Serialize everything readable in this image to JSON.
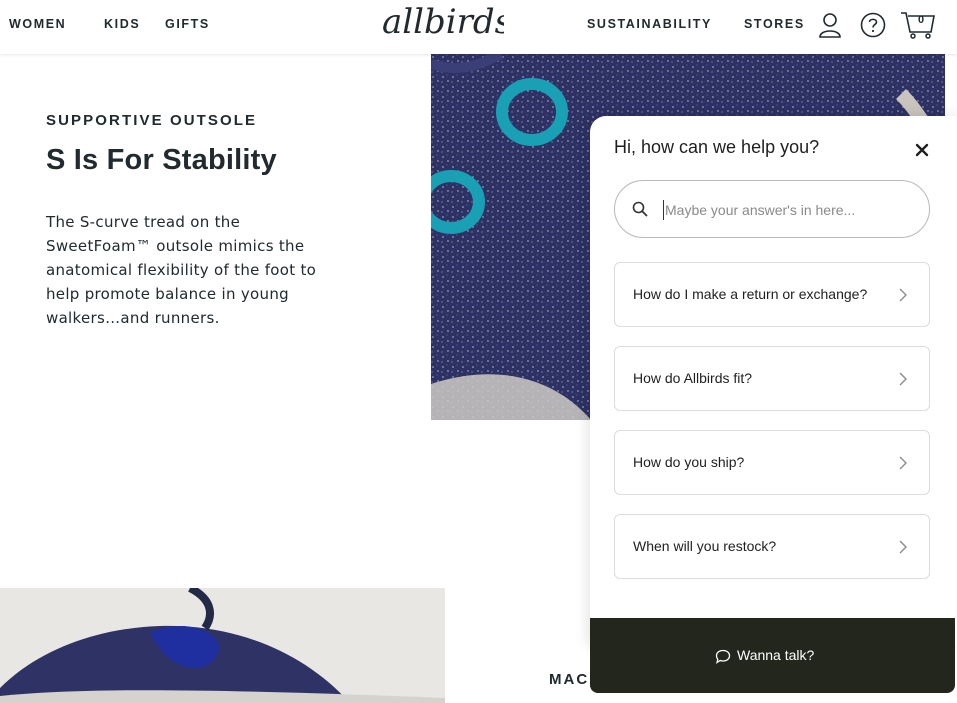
{
  "header": {
    "nav_left": [
      "WOMEN",
      "KIDS",
      "GIFTS"
    ],
    "logo_text": "allbirds",
    "nav_right": [
      "SUSTAINABILITY",
      "STORES"
    ],
    "cart_count": "0",
    "icons": [
      "account-icon",
      "help-icon",
      "cart-icon"
    ]
  },
  "feature": {
    "eyebrow": "SUPPORTIVE OUTSOLE",
    "headline": "S Is For Stability",
    "body": "The S-curve tread on the SweetFoam™ outsole mimics the anatomical flexibility of the foot to help promote balance in young walkers…and runners."
  },
  "section2": {
    "title_partial": "MAC"
  },
  "help_widget": {
    "title": "Hi, how can we help you?",
    "search_placeholder": "Maybe your answer's in here...",
    "faqs": [
      "How do I make a return or exchange?",
      "How do Allbirds fit?",
      "How do you ship?",
      "When will you restock?"
    ],
    "talk_label": "Wanna talk?"
  },
  "colors": {
    "text_primary": "#212a2f",
    "talk_bar_bg": "#22261c",
    "eyelet_teal": "#1aa0b5",
    "knit_navy": "#2b2f5e"
  }
}
